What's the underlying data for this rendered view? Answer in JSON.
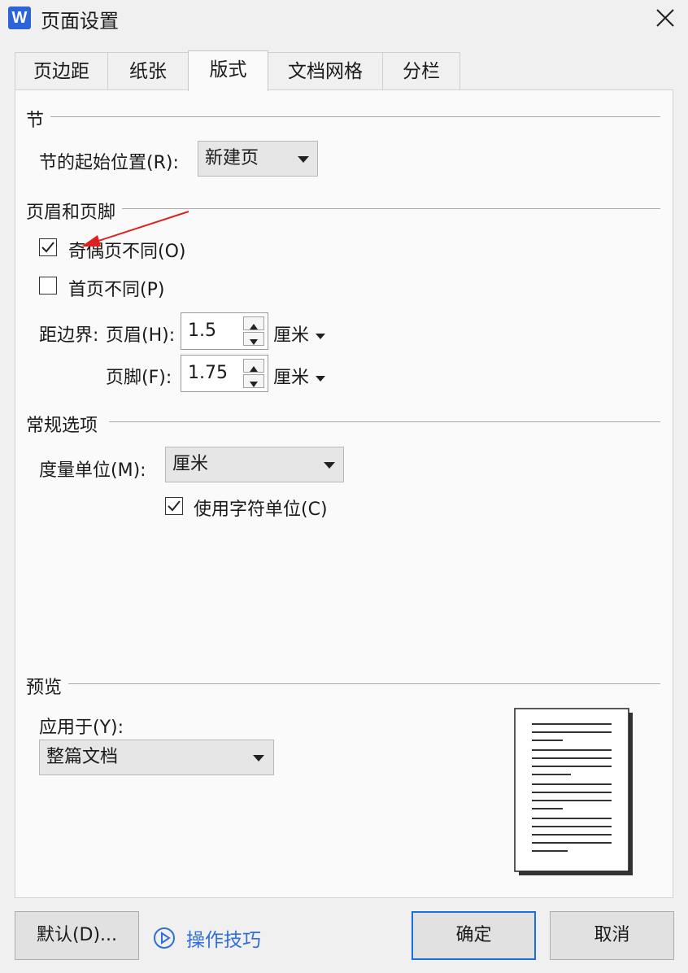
{
  "window": {
    "title": "页面设置",
    "app_icon": "W"
  },
  "tabs": [
    {
      "label": "页边距"
    },
    {
      "label": "纸张"
    },
    {
      "label": "版式",
      "active": true
    },
    {
      "label": "文档网格"
    },
    {
      "label": "分栏"
    }
  ],
  "section": {
    "heading": "节",
    "start_label": "节的起始位置(R):",
    "start_value": "新建页"
  },
  "header_footer": {
    "heading": "页眉和页脚",
    "odd_even_label": "奇偶页不同(O)",
    "odd_even_checked": true,
    "first_page_label": "首页不同(P)",
    "first_page_checked": false,
    "distance_label": "距边界:",
    "header_label": "页眉(H):",
    "header_value": "1.5",
    "footer_label": "页脚(F):",
    "footer_value": "1.75",
    "unit": "厘米"
  },
  "general": {
    "heading": "常规选项",
    "measure_label": "度量单位(M):",
    "measure_value": "厘米",
    "char_unit_label": "使用字符单位(C)",
    "char_unit_checked": true
  },
  "preview": {
    "heading": "预览",
    "apply_label": "应用于(Y):",
    "apply_value": "整篇文档"
  },
  "footer": {
    "default_button": "默认(D)...",
    "tips_link": "操作技巧",
    "ok_button": "确定",
    "cancel_button": "取消"
  },
  "colors": {
    "accent": "#1a6ee0",
    "link": "#2f6fd6",
    "annotation_arrow": "#e02020"
  }
}
